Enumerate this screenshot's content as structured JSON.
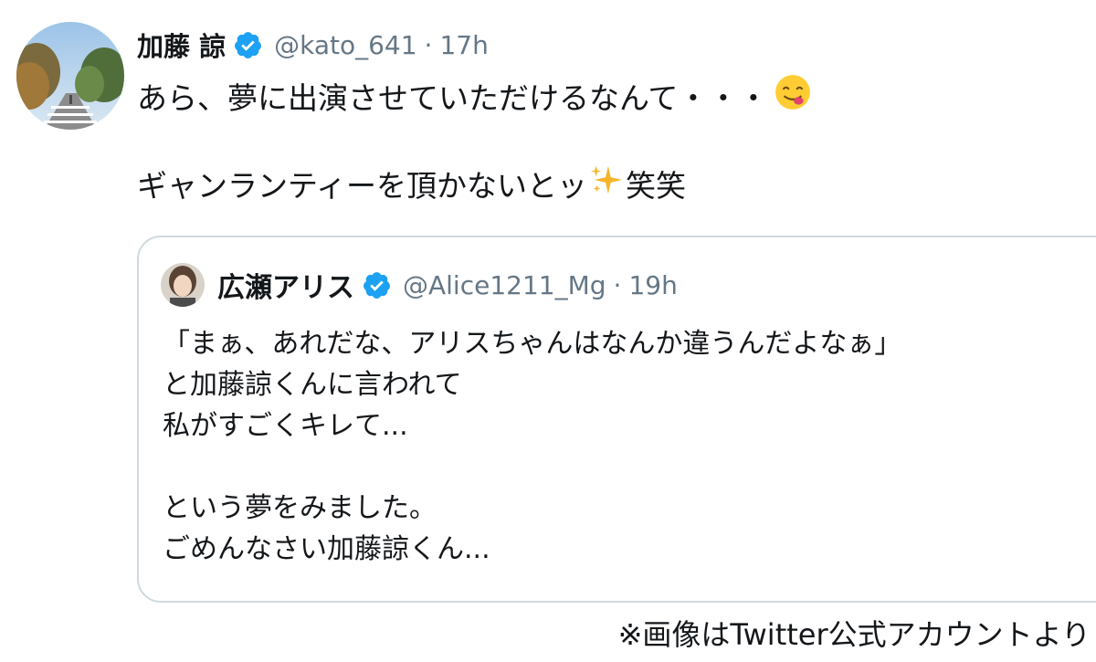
{
  "tweet": {
    "display_name": "加藤 諒",
    "handle": "@kato_641",
    "separator": "·",
    "time": "17h",
    "line1": "あら、夢に出演させていただけるなんて・・・",
    "line1_emoji": "savoring-food-face-icon",
    "line2": "ギャンランティーを頂かないとッ",
    "line2_emoji": "sparkles-icon",
    "line2_tail": "笑笑"
  },
  "quote": {
    "display_name": "広瀬アリス",
    "handle": "@Alice1211_Mg",
    "separator": "·",
    "time": "19h",
    "lines": [
      "「まぁ、あれだな、アリスちゃんはなんか違うんだよなぁ」",
      "と加藤諒くんに言われて",
      "私がすごくキレて...",
      "",
      "という夢をみました。",
      "ごめんなさい加藤諒くん..."
    ]
  },
  "caption": "※画像はTwitter公式アカウントより",
  "colors": {
    "text": "#14171a",
    "secondary": "#657786",
    "verified": "#1da1f2",
    "border": "#cfd9de"
  }
}
